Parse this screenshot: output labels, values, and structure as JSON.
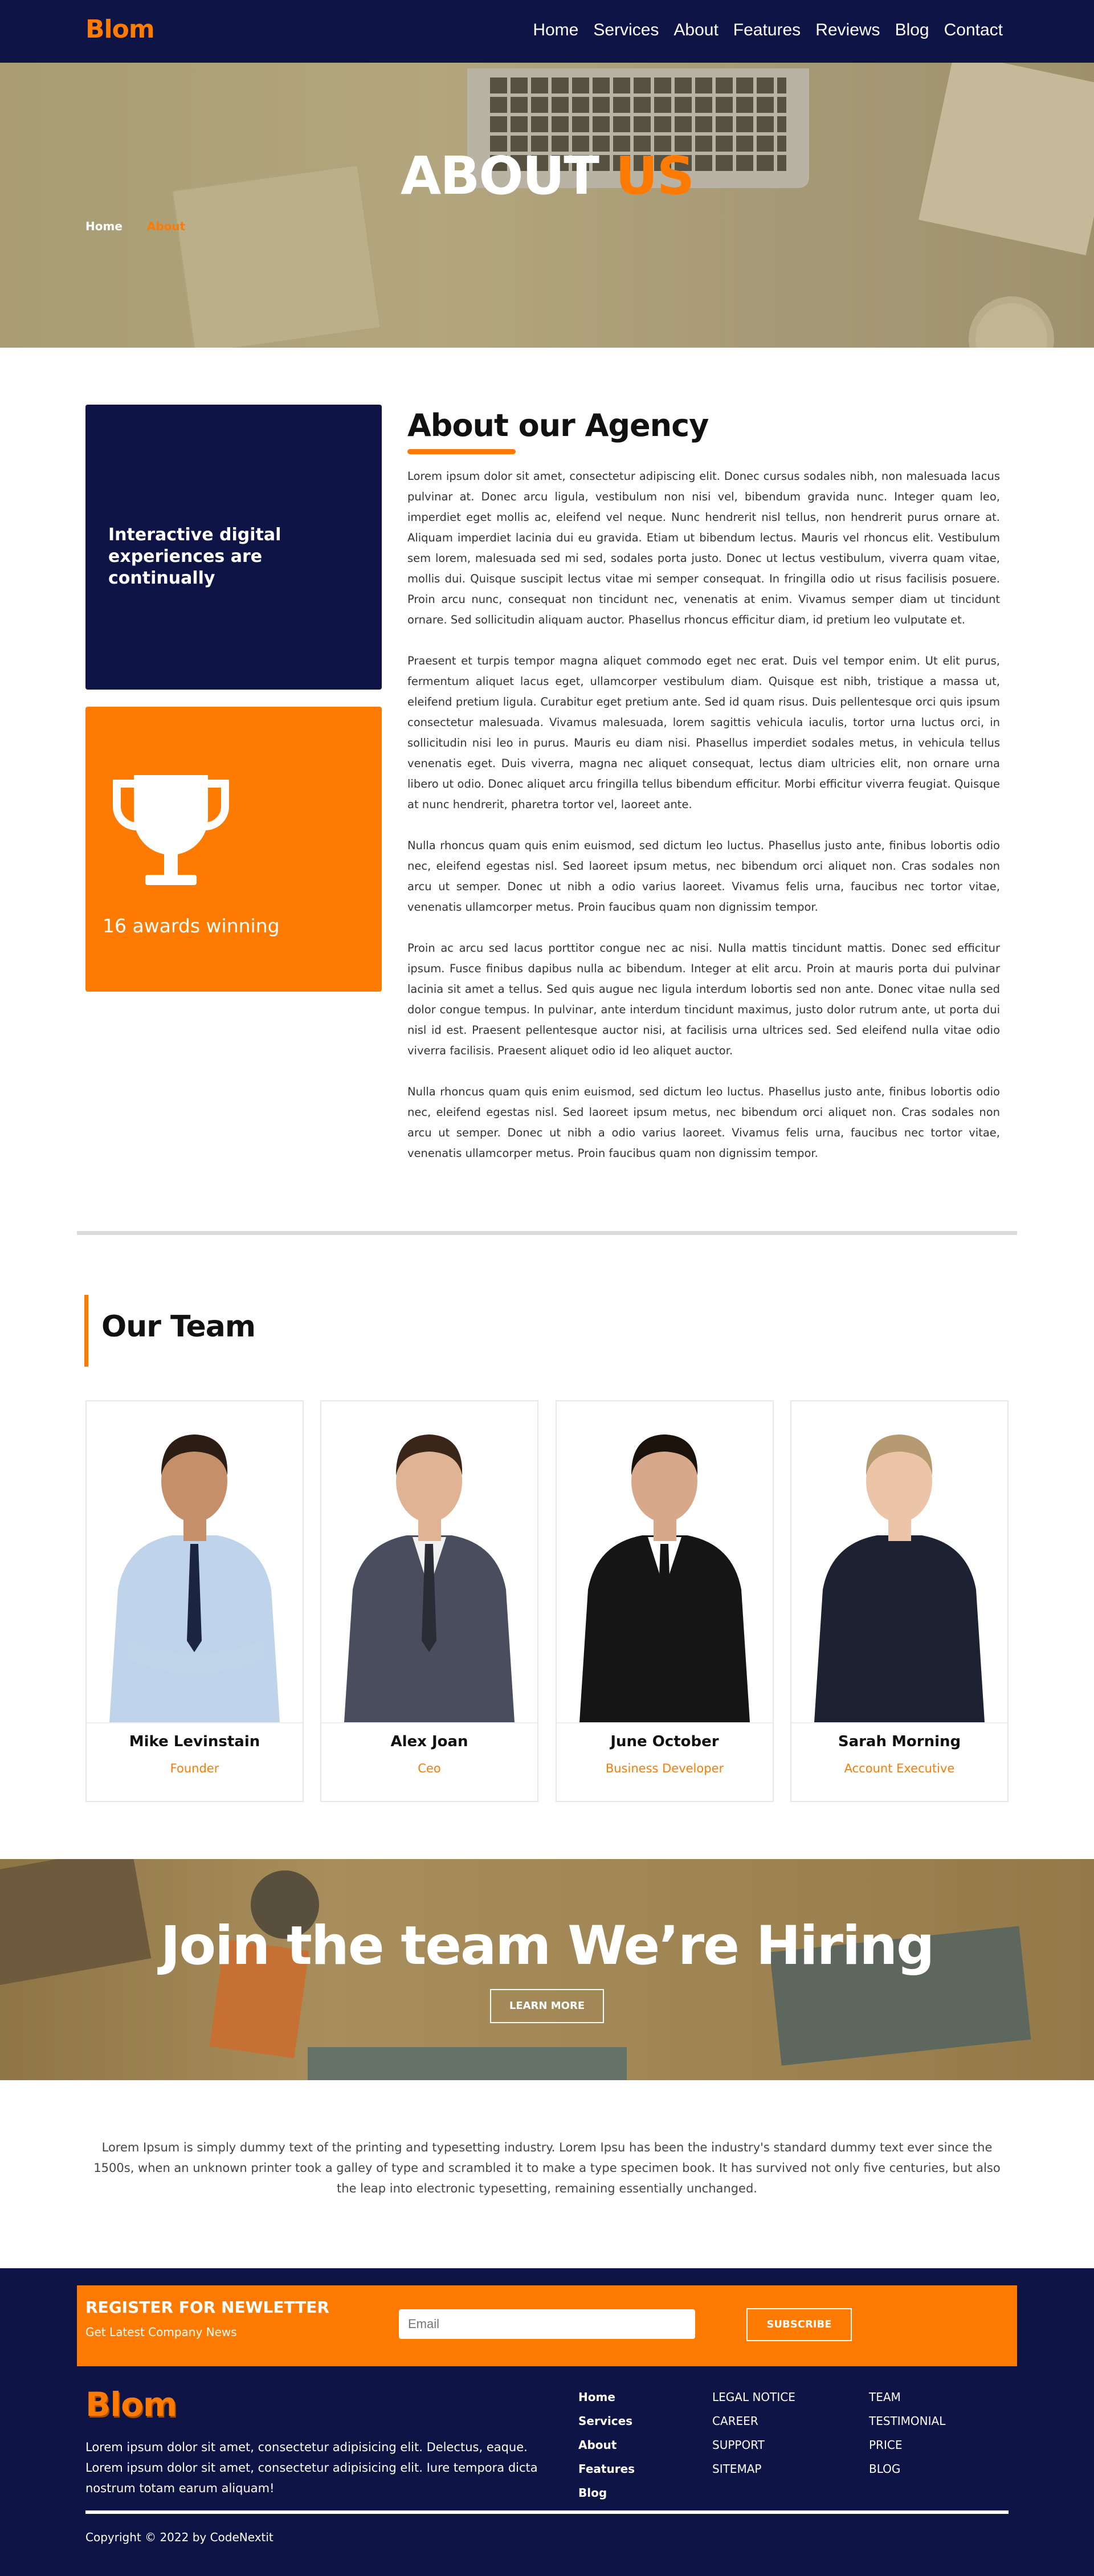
{
  "nav": {
    "logo": "Blom",
    "items": [
      "Home",
      "Services",
      "About",
      "Features",
      "Reviews",
      "Blog",
      "Contact"
    ]
  },
  "hero": {
    "title_main": "ABOUT",
    "title_accent": "US",
    "breadcrumb_home": "Home",
    "breadcrumb_current": "About"
  },
  "about": {
    "dark_card_text": "Interactive digital experiences are continually",
    "awards_text": "16 awards winning",
    "heading": "About our Agency",
    "paragraphs": [
      "Lorem ipsum dolor sit amet, consectetur adipiscing elit. Donec cursus sodales nibh, non malesuada lacus pulvinar at. Donec arcu ligula, vestibulum non nisi vel, bibendum gravida nunc. Integer quam leo, imperdiet eget mollis ac, eleifend vel neque. Nunc hendrerit nisl tellus, non hendrerit purus ornare at. Aliquam imperdiet lacinia dui eu gravida. Etiam ut bibendum lectus. Mauris vel rhoncus elit. Vestibulum sem lorem, malesuada sed mi sed, sodales porta justo. Donec ut lectus vestibulum, viverra quam vitae, mollis dui. Quisque suscipit lectus vitae mi semper consequat. In fringilla odio ut risus facilisis posuere. Proin arcu nunc, consequat non tincidunt nec, venenatis at enim. Vivamus semper diam ut tincidunt ornare. Sed sollicitudin aliquam auctor. Phasellus rhoncus efficitur diam, id pretium leo vulputate et.",
      "Praesent et turpis tempor magna aliquet commodo eget nec erat. Duis vel tempor enim. Ut elit purus, fermentum aliquet lacus eget, ullamcorper vestibulum diam. Quisque est nibh, tristique a massa ut, eleifend pretium ligula. Curabitur eget pretium ante. Sed id quam risus. Duis pellentesque orci quis ipsum consectetur malesuada. Vivamus malesuada, lorem sagittis vehicula iaculis, tortor urna luctus orci, in sollicitudin nisi leo in purus. Mauris eu diam nisi. Phasellus imperdiet sodales metus, in vehicula tellus venenatis eget. Duis viverra, magna nec aliquet consequat, lectus diam ultricies elit, non ornare urna libero ut odio. Donec aliquet arcu fringilla tellus bibendum efficitur. Morbi efficitur viverra feugiat. Quisque at nunc hendrerit, pharetra tortor vel, laoreet ante.",
      "Nulla rhoncus quam quis enim euismod, sed dictum leo luctus. Phasellus justo ante, finibus lobortis odio nec, eleifend egestas nisl. Sed laoreet ipsum metus, nec bibendum orci aliquet non. Cras sodales non arcu ut semper. Donec ut nibh a odio varius laoreet. Vivamus felis urna, faucibus nec tortor vitae, venenatis ullamcorper metus. Proin faucibus quam non dignissim tempor.",
      "Proin ac arcu sed lacus porttitor congue nec ac nisi. Nulla mattis tincidunt mattis. Donec sed efficitur ipsum. Fusce finibus dapibus nulla ac bibendum. Integer at elit arcu. Proin at mauris porta dui pulvinar lacinia sit amet a tellus. Sed quis augue nec ligula interdum lobortis sed non ante. Donec vitae nulla sed dolor congue tempus. In pulvinar, ante interdum tincidunt maximus, justo dolor rutrum ante, ut porta dui nisl id est. Praesent pellentesque auctor nisi, at facilisis urna ultrices sed. Sed eleifend nulla vitae odio viverra facilisis. Praesent aliquet odio id leo aliquet auctor.",
      "Nulla rhoncus quam quis enim euismod, sed dictum leo luctus. Phasellus justo ante, finibus lobortis odio nec, eleifend egestas nisl. Sed laoreet ipsum metus, nec bibendum orci aliquet non. Cras sodales non arcu ut semper. Donec ut nibh a odio varius laoreet. Vivamus felis urna, faucibus nec tortor vitae, venenatis ullamcorper metus. Proin faucibus quam non dignissim tempor."
    ]
  },
  "team": {
    "heading": "Our Team",
    "members": [
      {
        "name": "Mike Levinstain",
        "role": "Founder",
        "shirt": "#bfd3ea",
        "suit": "#bfd3ea",
        "tie": "#1b2440",
        "skin": "#c58f6a",
        "hair": "#2b1d14"
      },
      {
        "name": "Alex Joan",
        "role": "Ceo",
        "shirt": "#f1f1f1",
        "suit": "#4a4d5e",
        "tie": "#2a2c36",
        "skin": "#e0b394",
        "hair": "#3a2618"
      },
      {
        "name": "June October",
        "role": "Business Developer",
        "shirt": "#ffffff",
        "suit": "#151515",
        "tie": "#151515",
        "skin": "#d7a98a",
        "hair": "#1b120c"
      },
      {
        "name": "Sarah Morning",
        "role": "Account Executive",
        "shirt": "#1d2233",
        "suit": "#1d2233",
        "tie": "#1d2233",
        "skin": "#ecc4a8",
        "hair": "#b69a72"
      }
    ]
  },
  "hiring": {
    "title": "Join the team We’re Hiring",
    "button": "LEARN MORE"
  },
  "intro": {
    "text": "Lorem Ipsum is simply dummy text of the printing and typesetting industry. Lorem Ipsu has been the industry's standard dummy text ever since the 1500s, when an unknown printer took a galley of type and scrambled it to make a type specimen book. It has survived not only five centuries, but also the leap into electronic typesetting, remaining essentially unchanged."
  },
  "newsletter": {
    "heading": "REGISTER FOR NEWLETTER",
    "subtext": "Get Latest Company News",
    "email_placeholder": "Email",
    "button": "SUBSCRIBE"
  },
  "footer": {
    "logo": "Blom",
    "description": "Lorem ipsum dolor sit amet, consectetur adipisicing elit. Delectus, eaque. Lorem ipsum dolor sit amet, consectetur adipisicing elit. Iure tempora dicta nostrum totam earum aliquam!",
    "col1": [
      "Home",
      "Services",
      "About",
      "Features",
      "Blog"
    ],
    "col2": [
      "LEGAL NOTICE",
      "CAREER",
      "SUPPORT",
      "SITEMAP"
    ],
    "col3": [
      "TEAM",
      "TESTIMONIAL",
      "PRICE",
      "BLOG"
    ],
    "copyright": "Copyright © 2022 by CodeNextit"
  },
  "colors": {
    "navy": "#0e1446",
    "accent": "#ff7a00"
  },
  "icons": [
    "trophy-icon"
  ]
}
